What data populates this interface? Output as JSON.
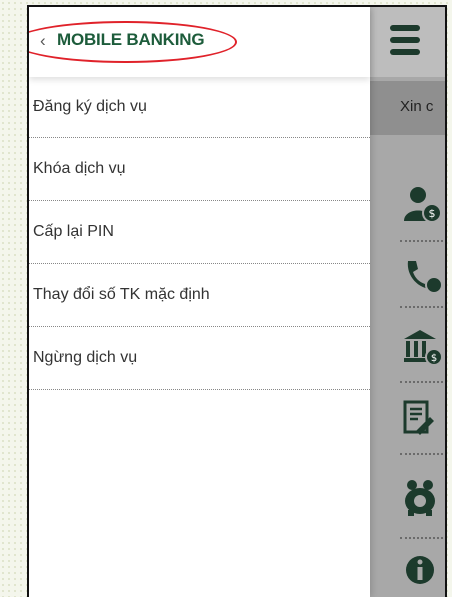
{
  "header": {
    "back_icon": "chevron-left-icon",
    "title": "MOBILE BANKING"
  },
  "menu": {
    "items": [
      {
        "label": "Đăng ký dịch vụ"
      },
      {
        "label": "Khóa dịch vụ"
      },
      {
        "label": "Cấp lại PIN"
      },
      {
        "label": "Thay đổi số TK mặc định"
      },
      {
        "label": "Ngừng dịch vụ"
      }
    ]
  },
  "background_app": {
    "greeting": "Xin c",
    "menu_icon": "hamburger-icon",
    "icons": [
      "user-money-icon",
      "phone-money-icon",
      "bank-money-icon",
      "document-sign-icon",
      "piggy-bank-icon",
      "info-icon"
    ]
  },
  "colors": {
    "title_green": "#1d5c3b",
    "highlight_red": "#e0222a",
    "panel_gray": "#a8a8a8",
    "icon_dark_green": "#1c3a2c"
  }
}
